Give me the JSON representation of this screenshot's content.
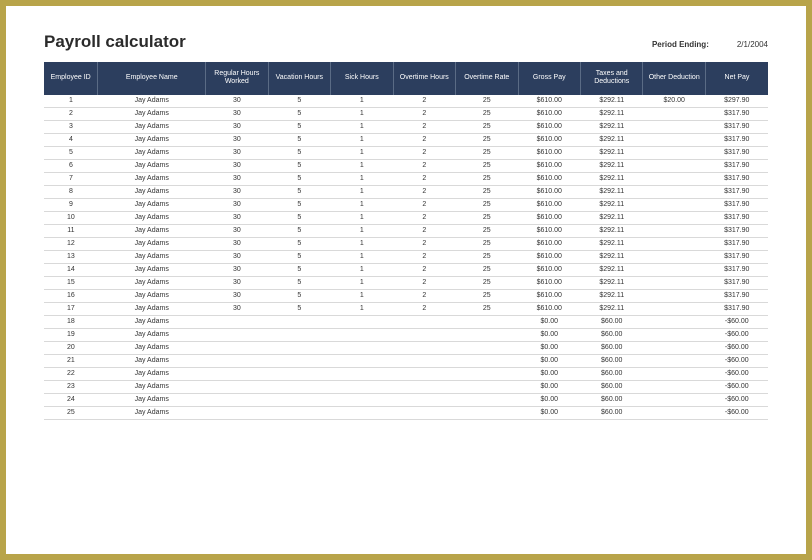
{
  "header": {
    "title": "Payroll calculator",
    "period_label": "Period Ending:",
    "period_value": "2/1/2004"
  },
  "columns": [
    "Employee ID",
    "Employee Name",
    "Regular Hours Worked",
    "Vacation Hours",
    "Sick Hours",
    "Overtime Hours",
    "Overtime Rate",
    "Gross Pay",
    "Taxes and Deductions",
    "Other Deduction",
    "Net Pay"
  ],
  "rows": [
    {
      "id": "1",
      "name": "Jay Adams",
      "reg": "30",
      "vac": "5",
      "sick": "1",
      "oth": "2",
      "otr": "25",
      "gross": "$610.00",
      "tax": "$292.11",
      "other": "$20.00",
      "net": "$297.90"
    },
    {
      "id": "2",
      "name": "Jay Adams",
      "reg": "30",
      "vac": "5",
      "sick": "1",
      "oth": "2",
      "otr": "25",
      "gross": "$610.00",
      "tax": "$292.11",
      "other": "",
      "net": "$317.90"
    },
    {
      "id": "3",
      "name": "Jay Adams",
      "reg": "30",
      "vac": "5",
      "sick": "1",
      "oth": "2",
      "otr": "25",
      "gross": "$610.00",
      "tax": "$292.11",
      "other": "",
      "net": "$317.90"
    },
    {
      "id": "4",
      "name": "Jay Adams",
      "reg": "30",
      "vac": "5",
      "sick": "1",
      "oth": "2",
      "otr": "25",
      "gross": "$610.00",
      "tax": "$292.11",
      "other": "",
      "net": "$317.90"
    },
    {
      "id": "5",
      "name": "Jay Adams",
      "reg": "30",
      "vac": "5",
      "sick": "1",
      "oth": "2",
      "otr": "25",
      "gross": "$610.00",
      "tax": "$292.11",
      "other": "",
      "net": "$317.90"
    },
    {
      "id": "6",
      "name": "Jay Adams",
      "reg": "30",
      "vac": "5",
      "sick": "1",
      "oth": "2",
      "otr": "25",
      "gross": "$610.00",
      "tax": "$292.11",
      "other": "",
      "net": "$317.90"
    },
    {
      "id": "7",
      "name": "Jay Adams",
      "reg": "30",
      "vac": "5",
      "sick": "1",
      "oth": "2",
      "otr": "25",
      "gross": "$610.00",
      "tax": "$292.11",
      "other": "",
      "net": "$317.90"
    },
    {
      "id": "8",
      "name": "Jay Adams",
      "reg": "30",
      "vac": "5",
      "sick": "1",
      "oth": "2",
      "otr": "25",
      "gross": "$610.00",
      "tax": "$292.11",
      "other": "",
      "net": "$317.90"
    },
    {
      "id": "9",
      "name": "Jay Adams",
      "reg": "30",
      "vac": "5",
      "sick": "1",
      "oth": "2",
      "otr": "25",
      "gross": "$610.00",
      "tax": "$292.11",
      "other": "",
      "net": "$317.90"
    },
    {
      "id": "10",
      "name": "Jay Adams",
      "reg": "30",
      "vac": "5",
      "sick": "1",
      "oth": "2",
      "otr": "25",
      "gross": "$610.00",
      "tax": "$292.11",
      "other": "",
      "net": "$317.90"
    },
    {
      "id": "11",
      "name": "Jay Adams",
      "reg": "30",
      "vac": "5",
      "sick": "1",
      "oth": "2",
      "otr": "25",
      "gross": "$610.00",
      "tax": "$292.11",
      "other": "",
      "net": "$317.90"
    },
    {
      "id": "12",
      "name": "Jay Adams",
      "reg": "30",
      "vac": "5",
      "sick": "1",
      "oth": "2",
      "otr": "25",
      "gross": "$610.00",
      "tax": "$292.11",
      "other": "",
      "net": "$317.90"
    },
    {
      "id": "13",
      "name": "Jay Adams",
      "reg": "30",
      "vac": "5",
      "sick": "1",
      "oth": "2",
      "otr": "25",
      "gross": "$610.00",
      "tax": "$292.11",
      "other": "",
      "net": "$317.90"
    },
    {
      "id": "14",
      "name": "Jay Adams",
      "reg": "30",
      "vac": "5",
      "sick": "1",
      "oth": "2",
      "otr": "25",
      "gross": "$610.00",
      "tax": "$292.11",
      "other": "",
      "net": "$317.90"
    },
    {
      "id": "15",
      "name": "Jay Adams",
      "reg": "30",
      "vac": "5",
      "sick": "1",
      "oth": "2",
      "otr": "25",
      "gross": "$610.00",
      "tax": "$292.11",
      "other": "",
      "net": "$317.90"
    },
    {
      "id": "16",
      "name": "Jay Adams",
      "reg": "30",
      "vac": "5",
      "sick": "1",
      "oth": "2",
      "otr": "25",
      "gross": "$610.00",
      "tax": "$292.11",
      "other": "",
      "net": "$317.90"
    },
    {
      "id": "17",
      "name": "Jay Adams",
      "reg": "30",
      "vac": "5",
      "sick": "1",
      "oth": "2",
      "otr": "25",
      "gross": "$610.00",
      "tax": "$292.11",
      "other": "",
      "net": "$317.90"
    },
    {
      "id": "18",
      "name": "Jay Adams",
      "reg": "",
      "vac": "",
      "sick": "",
      "oth": "",
      "otr": "",
      "gross": "$0.00",
      "tax": "$60.00",
      "other": "",
      "net": "-$60.00"
    },
    {
      "id": "19",
      "name": "Jay Adams",
      "reg": "",
      "vac": "",
      "sick": "",
      "oth": "",
      "otr": "",
      "gross": "$0.00",
      "tax": "$60.00",
      "other": "",
      "net": "-$60.00"
    },
    {
      "id": "20",
      "name": "Jay Adams",
      "reg": "",
      "vac": "",
      "sick": "",
      "oth": "",
      "otr": "",
      "gross": "$0.00",
      "tax": "$60.00",
      "other": "",
      "net": "-$60.00"
    },
    {
      "id": "21",
      "name": "Jay Adams",
      "reg": "",
      "vac": "",
      "sick": "",
      "oth": "",
      "otr": "",
      "gross": "$0.00",
      "tax": "$60.00",
      "other": "",
      "net": "-$60.00"
    },
    {
      "id": "22",
      "name": "Jay Adams",
      "reg": "",
      "vac": "",
      "sick": "",
      "oth": "",
      "otr": "",
      "gross": "$0.00",
      "tax": "$60.00",
      "other": "",
      "net": "-$60.00"
    },
    {
      "id": "23",
      "name": "Jay Adams",
      "reg": "",
      "vac": "",
      "sick": "",
      "oth": "",
      "otr": "",
      "gross": "$0.00",
      "tax": "$60.00",
      "other": "",
      "net": "-$60.00"
    },
    {
      "id": "24",
      "name": "Jay Adams",
      "reg": "",
      "vac": "",
      "sick": "",
      "oth": "",
      "otr": "",
      "gross": "$0.00",
      "tax": "$60.00",
      "other": "",
      "net": "-$60.00"
    },
    {
      "id": "25",
      "name": "Jay Adams",
      "reg": "",
      "vac": "",
      "sick": "",
      "oth": "",
      "otr": "",
      "gross": "$0.00",
      "tax": "$60.00",
      "other": "",
      "net": "-$60.00"
    }
  ]
}
